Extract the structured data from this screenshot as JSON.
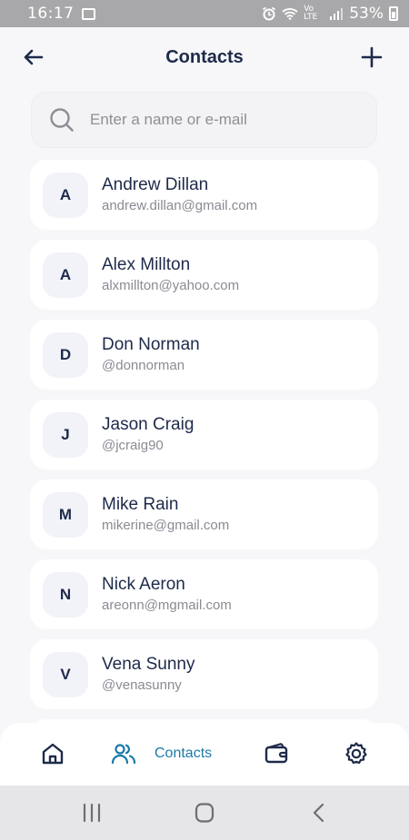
{
  "status_bar": {
    "time": "16:17",
    "network": "Vo LTE",
    "battery": "53%"
  },
  "header": {
    "title": "Contacts"
  },
  "search": {
    "placeholder": "Enter a name or e-mail"
  },
  "contacts": [
    {
      "initial": "A",
      "name": "Andrew Dillan",
      "detail": "andrew.dillan@gmail.com"
    },
    {
      "initial": "A",
      "name": "Alex Millton",
      "detail": "alxmillton@yahoo.com"
    },
    {
      "initial": "D",
      "name": "Don Norman",
      "detail": "@donnorman"
    },
    {
      "initial": "J",
      "name": "Jason Craig",
      "detail": "@jcraig90"
    },
    {
      "initial": "M",
      "name": "Mike Rain",
      "detail": "mikerine@gmail.com"
    },
    {
      "initial": "N",
      "name": "Nick Aeron",
      "detail": "areonn@mgmail.com"
    },
    {
      "initial": "V",
      "name": "Vena Sunny",
      "detail": "@venasunny"
    }
  ],
  "bottom_nav": {
    "items": [
      {
        "icon": "home-icon"
      },
      {
        "icon": "contacts-icon",
        "label": "Contacts",
        "active": true
      },
      {
        "icon": "wallet-icon"
      },
      {
        "icon": "gear-icon"
      }
    ]
  },
  "colors": {
    "accent": "#1b79a8",
    "text": "#1e2a4a",
    "background": "#f7f7f9",
    "card": "#ffffff"
  }
}
